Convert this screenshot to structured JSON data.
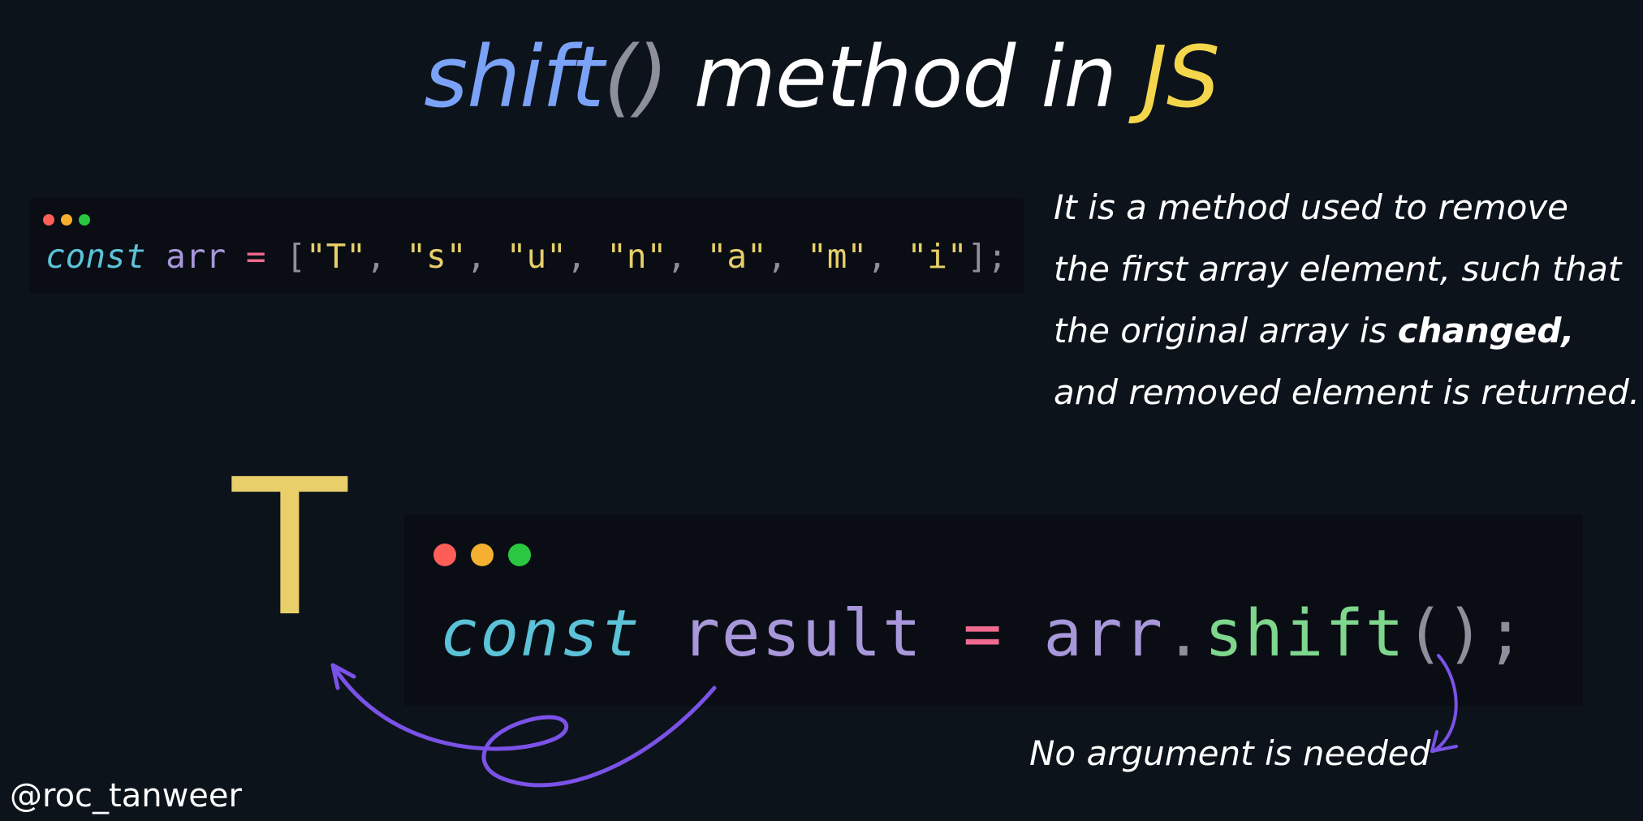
{
  "title": {
    "method": "shift",
    "parens": "()",
    "middle": " method in ",
    "language": "JS"
  },
  "snippet_small": {
    "keyword": "const",
    "variable": "arr",
    "operator": "=",
    "open_bracket": "[",
    "items": [
      "\"T\"",
      "\"s\"",
      "\"u\"",
      "\"n\"",
      "\"a\"",
      "\"m\"",
      "\"i\""
    ],
    "separator": ", ",
    "close_bracket": "]",
    "terminator": ";"
  },
  "snippet_big": {
    "keyword": "const",
    "variable": "result",
    "operator": "=",
    "object": "arr",
    "dot": ".",
    "method": "shift",
    "parens": "()",
    "terminator": ";"
  },
  "description": {
    "line1": "It is a method used to remove",
    "line2": "the first array element, such that",
    "line3_start": "the original array is ",
    "line3_bold": "changed,",
    "line4": "and removed element is returned."
  },
  "result_value": "T",
  "annotation": "No argument is needed",
  "handle": "@roc_tanweer",
  "colors": {
    "background": "#0d131b",
    "code_background": "#0a0e14",
    "keyword": "#5cc2d8",
    "variable": "#a897da",
    "operator": "#f06a8f",
    "string": "#e8cf6a",
    "function": "#7fd68d",
    "punctuation": "#8d8f9a",
    "arrow": "#7b52e8",
    "title_method": "#7aa2f7",
    "title_language": "#f4d64c"
  }
}
